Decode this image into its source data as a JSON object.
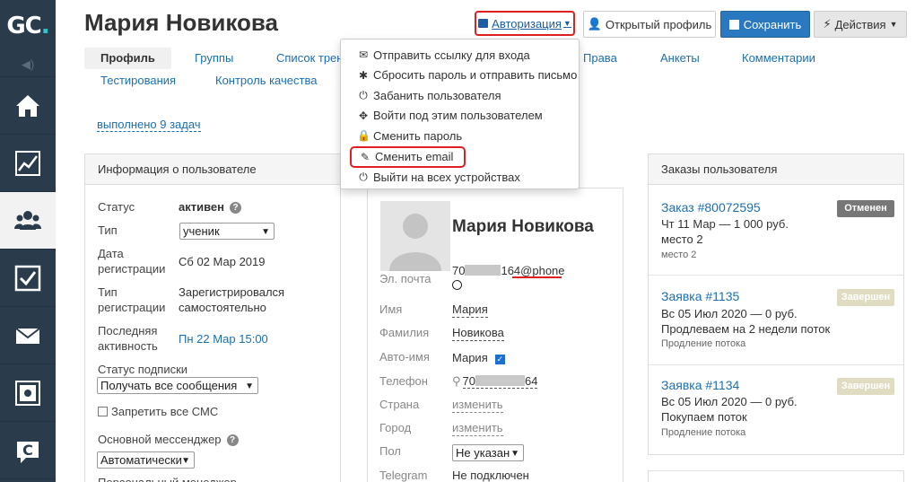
{
  "sidebar": {
    "logo_text": "GC",
    "logo_dot": ".",
    "items": [
      {
        "icon": "home-icon"
      },
      {
        "icon": "chart-icon"
      },
      {
        "icon": "users-icon",
        "active": true
      },
      {
        "icon": "tasks-icon"
      },
      {
        "icon": "mail-icon"
      },
      {
        "icon": "safe-icon"
      },
      {
        "icon": "chat-icon"
      }
    ]
  },
  "header": {
    "user_name": "Мария Новикова",
    "buttons": {
      "auth": "Авторизация",
      "open_profile": "Открытый профиль",
      "save": "Сохранить",
      "actions": "Действия"
    }
  },
  "tabs": [
    {
      "label": "Профиль",
      "active": true
    },
    {
      "label": "Группы"
    },
    {
      "label": "Список трен"
    },
    {
      "label": "Права"
    },
    {
      "label": "Анкеты"
    },
    {
      "label": "Комментарии"
    },
    {
      "label": "Тестирования"
    },
    {
      "label": "Контроль качества"
    }
  ],
  "dropdown": {
    "items": [
      {
        "icon": "envelope-icon",
        "label": "Отправить ссылку для входа"
      },
      {
        "icon": "asterisk-icon",
        "label": "Сбросить пароль и отправить письмо"
      },
      {
        "icon": "power-icon",
        "label": "Забанить пользователя"
      },
      {
        "icon": "move-icon",
        "label": "Войти под этим пользователем"
      },
      {
        "icon": "lock-icon",
        "label": "Сменить пароль"
      },
      {
        "icon": "edit-icon",
        "label": "Сменить email",
        "highlighted": true
      },
      {
        "icon": "power-icon",
        "label": "Выйти на всех устройствах"
      }
    ]
  },
  "tasks_link": "выполнено 9 задач",
  "info_panel": {
    "title": "Информация о пользователе",
    "status_label": "Статус",
    "status_value": "активен",
    "type_label": "Тип",
    "type_value": "ученик",
    "reg_date_label_1": "Дата",
    "reg_date_label_2": "регистрации",
    "reg_date_value": "Сб 02 Мар 2019",
    "reg_type_label_1": "Тип",
    "reg_type_label_2": "регистрации",
    "reg_type_value_1": "Зарегистрировался",
    "reg_type_value_2": "самостоятельно",
    "last_activity_label_1": "Последняя",
    "last_activity_label_2": "активность",
    "last_activity_value": "Пн 22 Мар 15:00",
    "subscription_label": "Статус подписки",
    "subscription_value": "Получать все сообщения",
    "ban_sms_label": "Запретить все СМС",
    "messenger_label": "Основной мессенджер",
    "messenger_value": "Автоматически",
    "personal_manager_label": "Персональный менеджер"
  },
  "profile_card": {
    "name": "Мария Новикова",
    "email_label": "Эл. почта",
    "email_prefix": "70",
    "email_suffix": "164@phone",
    "first_name_label": "Имя",
    "first_name_value": "Мария",
    "last_name_label": "Фамилия",
    "last_name_value": "Новикова",
    "auto_name_label": "Авто-имя",
    "auto_name_value": "Мария",
    "phone_label": "Телефон",
    "phone_prefix": "70",
    "phone_suffix": "64",
    "country_label": "Страна",
    "country_value": "изменить",
    "city_label": "Город",
    "city_value": "изменить",
    "gender_label": "Пол",
    "gender_value": "Не указан",
    "telegram_label": "Telegram",
    "telegram_value": "Не подключен"
  },
  "orders_panel": {
    "title": "Заказы пользователя",
    "orders": [
      {
        "title": "Заказ #80072595",
        "line1": "Чт 11 Мар — 1 000 руб.",
        "line2": "место 2",
        "small": "место 2",
        "badge": "Отменен",
        "status": "cancel"
      },
      {
        "title": "Заявка #1135",
        "line1": "Вс 05 Июл 2020 — 0 руб.",
        "line2": "Продлеваем на 2 недели поток",
        "small": "Продление потока",
        "badge": "Завершен",
        "status": "done"
      },
      {
        "title": "Заявка #1134",
        "line1": "Вс 05 Июл 2020 — 0 руб.",
        "line2": "Покупаем поток",
        "small": "Продление потока",
        "badge": "Завершен",
        "status": "done"
      }
    ]
  }
}
